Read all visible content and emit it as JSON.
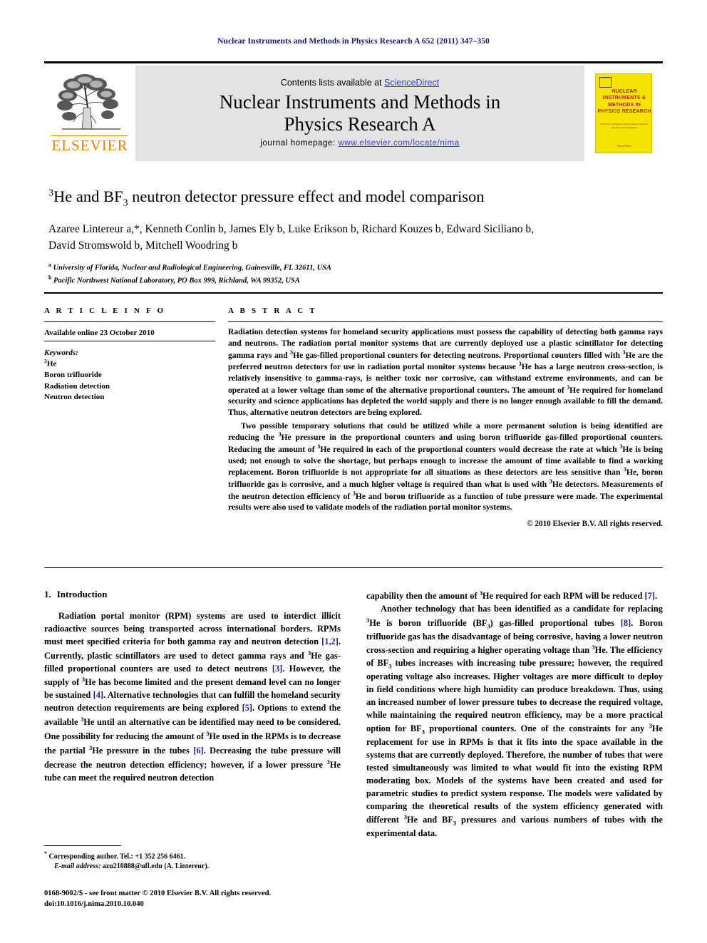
{
  "running_head": "Nuclear Instruments and Methods in Physics Research A 652 (2011) 347–350",
  "masthead": {
    "contents_prefix": "Contents lists available at ",
    "sciencedirect": "ScienceDirect",
    "journal_title_line1": "Nuclear Instruments and Methods in",
    "journal_title_line2": "Physics Research A",
    "homepage_prefix": "journal homepage: ",
    "homepage_url": "www.elsevier.com/locate/nima",
    "publisher_wordmark": "ELSEVIER",
    "cover": {
      "title": "NUCLEAR INSTRUMENTS & METHODS IN PHYSICS RESEARCH",
      "subtitle": "Section A: Accelerators, Spectrometers, Detectors and Associated Equipment",
      "footer": "ScienceDirect",
      "logo_text": "ELSEVIER",
      "bg_color": "#f5e400",
      "text_color": "#c02020"
    },
    "link_color": "#3b3bd0",
    "band_color": "#e3e3e3"
  },
  "article": {
    "title_pre": "He and BF",
    "title_sup": "3",
    "title_sub": "3",
    "title_post": " neutron detector pressure effect and model comparison",
    "title_plain": "3He and BF3 neutron detector pressure effect and model comparison",
    "authors_line1": "Azaree Lintereur a,*, Kenneth Conlin b, James Ely b, Luke Erikson b, Richard Kouzes b, Edward Siciliano b,",
    "authors_line2": "David Stromswold b, Mitchell Woodring b",
    "affiliations": [
      {
        "marker": "a",
        "text": "University of Florida, Nuclear and Radiological Engineering, Gainesville, FL 32611, USA"
      },
      {
        "marker": "b",
        "text": "Pacific Northwest National Laboratory, PO Box 999, Richland, WA 99352, USA"
      }
    ]
  },
  "article_info": {
    "label": "A R T I C L E   I N F O",
    "available_online": "Available online 23 October 2010",
    "keywords_label": "Keywords:",
    "keywords": [
      "3He",
      "Boron trifluoride",
      "Radiation detection",
      "Neutron detection"
    ]
  },
  "abstract": {
    "label": "A B S T R A C T",
    "paragraph1": "Radiation detection systems for homeland security applications must possess the capability of detecting both gamma rays and neutrons. The radiation portal monitor systems that are currently deployed use a plastic scintillator for detecting gamma rays and 3He gas-filled proportional counters for detecting neutrons. Proportional counters filled with 3He are the preferred neutron detectors for use in radiation portal monitor systems because 3He has a large neutron cross-section, is relatively insensitive to gamma-rays, is neither toxic nor corrosive, can withstand extreme environments, and can be operated at a lower voltage than some of the alternative proportional counters. The amount of 3He required for homeland security and science applications has depleted the world supply and there is no longer enough available to fill the demand. Thus, alternative neutron detectors are being explored.",
    "paragraph2": "Two possible temporary solutions that could be utilized while a more permanent solution is being identified are reducing the 3He pressure in the proportional counters and using boron trifluoride gas-filled proportional counters. Reducing the amount of 3He required in each of the proportional counters would decrease the rate at which 3He is being used; not enough to solve the shortage, but perhaps enough to increase the amount of time available to find a working replacement. Boron trifluoride is not appropriate for all situations as these detectors are less sensitive than 3He, boron trifluoride gas is corrosive, and a much higher voltage is required than what is used with 3He detectors. Measurements of the neutron detection efficiency of 3He and boron trifluoride as a function of tube pressure were made. The experimental results were also used to validate models of the radiation portal monitor systems.",
    "copyright": "© 2010 Elsevier B.V. All rights reserved."
  },
  "body": {
    "section_number": "1.",
    "section_title": "Introduction",
    "left_paragraph": "Radiation portal monitor (RPM) systems are used to interdict illicit radioactive sources being transported across international borders. RPMs must meet specified criteria for both gamma ray and neutron detection [1,2]. Currently, plastic scintillators are used to detect gamma rays and 3He gas-filled proportional counters are used to detect neutrons [3]. However, the supply of 3He has become limited and the present demand level can no longer be sustained [4]. Alternative technologies that can fulfill the homeland security neutron detection requirements are being explored [5]. Options to extend the available 3He until an alternative can be identified may need to be considered. One possibility for reducing the amount of 3He used in the RPMs is to decrease the partial 3He pressure in the tubes [6]. Decreasing the tube pressure will decrease the neutron detection efficiency; however, if a lower pressure 3He tube can meet the required neutron detection",
    "right_paragraph_continued": "capability then the amount of 3He required for each RPM will be reduced [7].",
    "right_paragraph2": "Another technology that has been identified as a candidate for replacing 3He is boron trifluoride (BF3) gas-filled proportional tubes [8]. Boron trifluoride gas has the disadvantage of being corrosive, having a lower neutron cross-section and requiring a higher operating voltage than 3He. The efficiency of BF3 tubes increases with increasing tube pressure; however, the required operating voltage also increases. Higher voltages are more difficult to deploy in field conditions where high humidity can produce breakdown. Thus, using an increased number of lower pressure tubes to decrease the required voltage, while maintaining the required neutron efficiency, may be a more practical option for BF3 proportional counters. One of the constraints for any 3He replacement for use in RPMs is that it fits into the space available in the systems that are currently deployed. Therefore, the number of tubes that were tested simultaneously was limited to what would fit into the existing RPM moderating box. Models of the systems have been created and used for parametric studies to predict system response. The models were validated by comparing the theoretical results of the system efficiency generated with different 3He and BF3 pressures and various numbers of tubes with the experimental data.",
    "citation_color": "#1a1a8c"
  },
  "footnote": {
    "corresponding": "Corresponding author. Tel.: +1 352 256 6461.",
    "email_label": "E-mail address:",
    "email_value": "azu210888@ufl.edu (A. Lintereur)."
  },
  "issn_line1": "0168-9002/$ - see front matter © 2010 Elsevier B.V. All rights reserved.",
  "issn_line2": "doi:10.1016/j.nima.2010.10.040"
}
